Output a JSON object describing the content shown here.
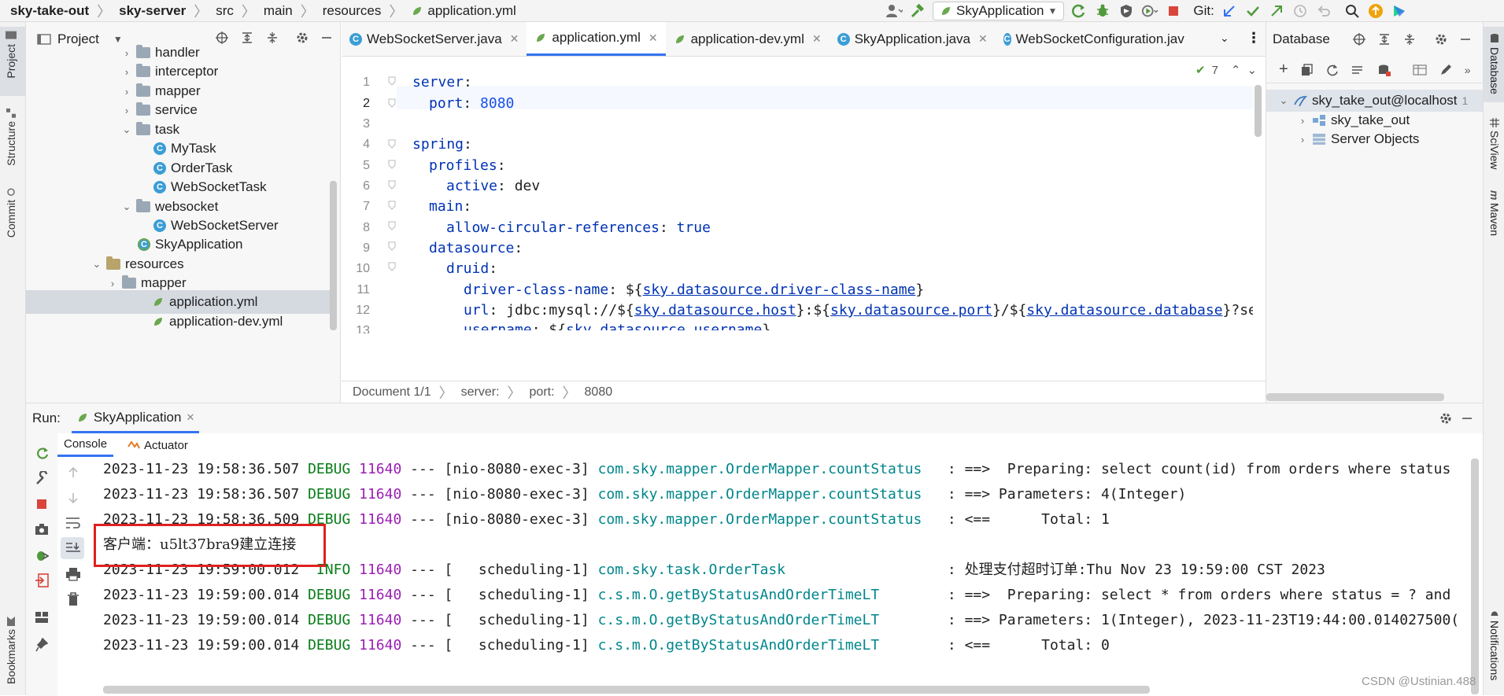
{
  "breadcrumb": {
    "items": [
      "sky-take-out",
      "sky-server",
      "src",
      "main",
      "resources",
      "application.yml"
    ]
  },
  "toolbar": {
    "run_config": "SkyApplication",
    "git_label": "Git:"
  },
  "left_strip": {
    "tabs": [
      "Project",
      "Structure",
      "Commit",
      "Bookmarks"
    ]
  },
  "project_panel": {
    "title": "Project",
    "tree": [
      {
        "label": "handler",
        "type": "folder",
        "expanded": false
      },
      {
        "label": "interceptor",
        "type": "folder",
        "expanded": false
      },
      {
        "label": "mapper",
        "type": "folder",
        "expanded": false
      },
      {
        "label": "service",
        "type": "folder",
        "expanded": false
      },
      {
        "label": "task",
        "type": "folder",
        "expanded": true
      },
      {
        "label": "MyTask",
        "type": "class"
      },
      {
        "label": "OrderTask",
        "type": "class"
      },
      {
        "label": "WebSocketTask",
        "type": "class"
      },
      {
        "label": "websocket",
        "type": "folder",
        "expanded": true
      },
      {
        "label": "WebSocketServer",
        "type": "class"
      },
      {
        "label": "SkyApplication",
        "type": "app"
      },
      {
        "label": "resources",
        "type": "resfolder",
        "expanded": true
      },
      {
        "label": "mapper",
        "type": "folder",
        "expanded": false
      },
      {
        "label": "application.yml",
        "type": "yml",
        "selected": true
      },
      {
        "label": "application-dev.yml",
        "type": "yml"
      }
    ]
  },
  "editor": {
    "tabs": [
      {
        "label": "WebSocketServer.java",
        "type": "java"
      },
      {
        "label": "application.yml",
        "type": "yml",
        "active": true
      },
      {
        "label": "application-dev.yml",
        "type": "yml"
      },
      {
        "label": "SkyApplication.java",
        "type": "app"
      },
      {
        "label": "WebSocketConfiguration.jav",
        "type": "java"
      }
    ],
    "inspection_count": "7",
    "line_numbers": [
      "1",
      "2",
      "3",
      "4",
      "5",
      "6",
      "7",
      "8",
      "9",
      "10",
      "11",
      "12",
      "13"
    ],
    "lines": {
      "l1_key": "server",
      "l2_key": "port",
      "l2_val": "8080",
      "l4_key": "spring",
      "l5_key": "profiles",
      "l6_key": "active",
      "l6_val": "dev",
      "l7_key": "main",
      "l8_key": "allow-circular-references",
      "l8_val": "true",
      "l9_key": "datasource",
      "l10_key": "druid",
      "l11_key": "driver-class-name",
      "l11_ref": "sky.datasource.driver-class-name",
      "l12_key": "url",
      "l12_prefix": "jdbc:mysql://${",
      "l12_host": "sky.datasource.host",
      "l12_port": "sky.datasource.port",
      "l12_db": "sky.datasource.database",
      "l12_suffix": "}?se",
      "l13_key": "username",
      "l13_ref": "sky.datasource.username"
    },
    "footer": [
      "Document 1/1",
      "server:",
      "port:",
      "8080"
    ]
  },
  "database_panel": {
    "title": "Database",
    "tree": [
      {
        "label": "sky_take_out@localhost",
        "badge": "1"
      },
      {
        "label": "sky_take_out"
      },
      {
        "label": "Server Objects"
      }
    ]
  },
  "right_strip": {
    "tabs": [
      "Database",
      "SciView",
      "Maven",
      "Notifications"
    ]
  },
  "run_panel": {
    "label": "Run:",
    "config_tab": "SkyApplication",
    "subtabs": [
      "Console",
      "Actuator"
    ],
    "console": [
      {
        "ts": "2023-11-23 19:58:36.507",
        "level": "DEBUG",
        "pid": "11640",
        "thread": "--- [nio-8080-exec-3]",
        "logger": "com.sky.mapper.OrderMapper.countStatus",
        "msg": "   : ==>  Preparing: select count(id) from orders where status"
      },
      {
        "ts": "2023-11-23 19:58:36.507",
        "level": "DEBUG",
        "pid": "11640",
        "thread": "--- [nio-8080-exec-3]",
        "logger": "com.sky.mapper.OrderMapper.countStatus",
        "msg": "   : ==> Parameters: 4(Integer)"
      },
      {
        "ts": "2023-11-23 19:58:36.509",
        "level": "DEBUG",
        "pid": "11640",
        "thread": "--- [nio-8080-exec-3]",
        "logger": "com.sky.mapper.OrderMapper.countStatus",
        "msg": "   : <==      Total: 1"
      },
      {
        "plain": "客户端：u5lt37bra9建立连接"
      },
      {
        "ts": "2023-11-23 19:59:00.012",
        "level": " INFO",
        "pid": "11640",
        "thread": "--- [   scheduling-1]",
        "logger": "com.sky.task.OrderTask",
        "msg": "                   : 处理支付超时订单:Thu Nov 23 19:59:00 CST 2023"
      },
      {
        "ts": "2023-11-23 19:59:00.014",
        "level": "DEBUG",
        "pid": "11640",
        "thread": "--- [   scheduling-1]",
        "logger": "c.s.m.O.getByStatusAndOrderTimeLT",
        "msg": "        : ==>  Preparing: select * from orders where status = ? and"
      },
      {
        "ts": "2023-11-23 19:59:00.014",
        "level": "DEBUG",
        "pid": "11640",
        "thread": "--- [   scheduling-1]",
        "logger": "c.s.m.O.getByStatusAndOrderTimeLT",
        "msg": "        : ==> Parameters: 1(Integer), 2023-11-23T19:44:00.014027500("
      },
      {
        "ts": "2023-11-23 19:59:00.014",
        "level": "DEBUG",
        "pid": "11640",
        "thread": "--- [   scheduling-1]",
        "logger": "c.s.m.O.getByStatusAndOrderTimeLT",
        "msg": "        : <==      Total: 0"
      }
    ]
  },
  "watermark": "CSDN @Ustinian.488"
}
